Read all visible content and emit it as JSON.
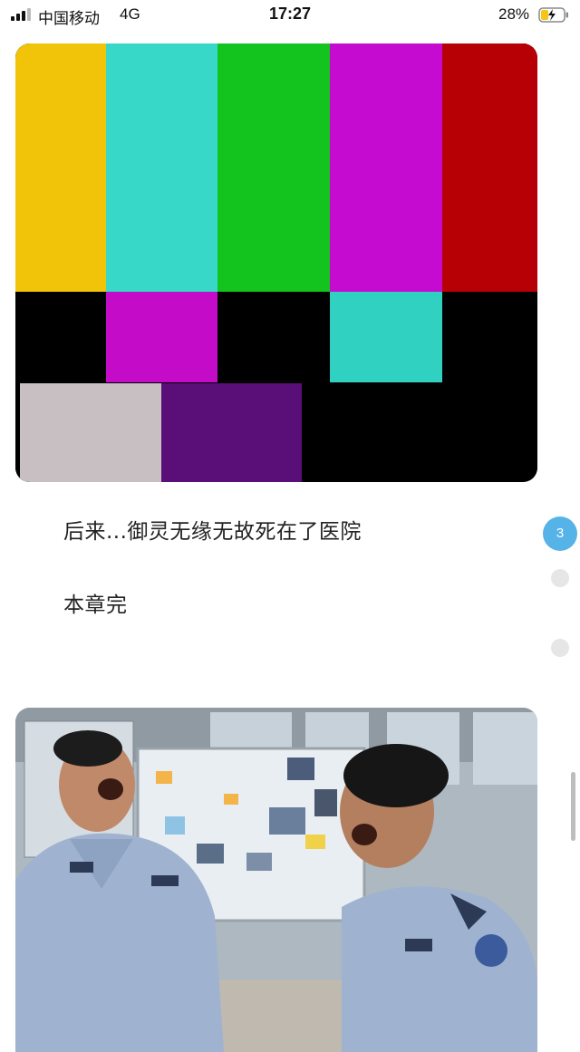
{
  "status_bar": {
    "carrier": "中国移动",
    "network": "4G",
    "time": "17:27",
    "battery_percent": "28%"
  },
  "article": {
    "paragraphs": [
      "后来...御灵无缘无故死在了医院",
      "本章完"
    ]
  },
  "pager": {
    "current_page": "3"
  },
  "colors": {
    "pager_accent": "#56b3e8",
    "battery_charging": "#f5c518"
  },
  "icons": [
    "signal-icon",
    "battery-charging-icon"
  ]
}
